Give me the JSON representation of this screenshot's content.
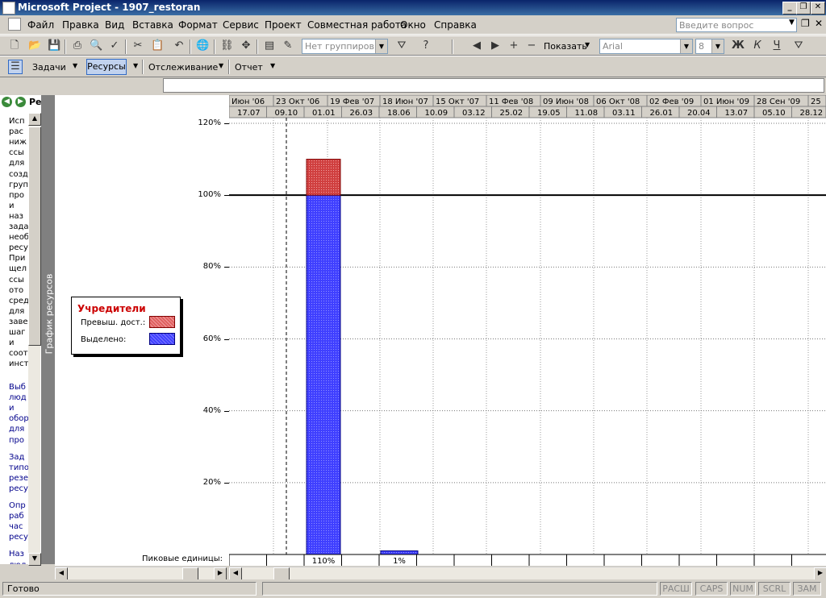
{
  "window": {
    "title": "Microsoft Project - 1907_restoran"
  },
  "menu": [
    "Файл",
    "Правка",
    "Вид",
    "Вставка",
    "Формат",
    "Сервис",
    "Проект",
    "Совместная работа",
    "Окно",
    "Справка"
  ],
  "question_placeholder": "Введите вопрос",
  "toolbar1": {
    "grouping": "Нет группировки",
    "show_label": "Показать",
    "font": "Arial",
    "font_size": "8"
  },
  "toolbar2": {
    "tasks": "Задачи",
    "resources": "Ресурсы",
    "tracking": "Отслеживание",
    "report": "Отчет"
  },
  "left_pane": {
    "header": "Ре",
    "text_lines": [
      "Исп",
      "рас",
      "ниж",
      "ссы",
      "для",
      "созд",
      "груп",
      "про",
      "и",
      "наз",
      "зада",
      "необ",
      "ресу",
      "При",
      "щел",
      "ссы",
      "ото",
      "сред",
      "для",
      "заве",
      "шаг",
      "и",
      "соот",
      "инст"
    ],
    "link_lines": [
      "Выб",
      "люд",
      "и",
      "обор",
      "для",
      "про",
      "Зад",
      "типо",
      "резе",
      "ресу",
      "Опр",
      "раб",
      "час",
      "ресу",
      "Наз",
      "люд"
    ]
  },
  "view_bar_label": "График ресурсов",
  "legend": {
    "title": "Учредители",
    "overalloc": "Превыш. дост.:",
    "allocated": "Выделено:"
  },
  "peak_label": "Пиковые единицы:",
  "timescale": {
    "major": [
      "Июн '06",
      "23 Окт '06",
      "19 Фев '07",
      "18 Июн '07",
      "15 Окт '07",
      "11 Фев '08",
      "09 Июн '08",
      "06 Окт '08",
      "02 Фев '09",
      "01 Июн '09",
      "28 Сен '09",
      "25"
    ],
    "minor": [
      "17.07",
      "09.10",
      "01.01",
      "26.03",
      "18.06",
      "10.09",
      "03.12",
      "25.02",
      "19.05",
      "11.08",
      "03.11",
      "26.01",
      "20.04",
      "13.07",
      "05.10",
      "28.12"
    ]
  },
  "chart_data": {
    "type": "bar",
    "ylim": [
      0,
      120
    ],
    "y_ticks": [
      "120%",
      "100%",
      "80%",
      "60%",
      "40%",
      "20%"
    ],
    "y_tick_values": [
      120,
      100,
      80,
      60,
      40,
      20
    ],
    "max_units_line": 100,
    "series": [
      {
        "name": "Выделено:",
        "color": "#4040ff"
      },
      {
        "name": "Превыш. дост.:",
        "color": "#e06060"
      }
    ],
    "bars": [
      {
        "period": "01.01",
        "allocated": 100,
        "overallocated": 10,
        "peak_label": "110%"
      },
      {
        "period": "18.06",
        "allocated": 1,
        "overallocated": 0,
        "peak_label": "1%"
      }
    ]
  },
  "status": {
    "ready": "Готово",
    "indicators": [
      "РАСШ",
      "CAPS",
      "NUM",
      "SCRL",
      "ЗАМ"
    ]
  },
  "colors": {
    "titlebar": "#0a246a",
    "legend_title": "#cc0000",
    "link": "#00008b"
  }
}
